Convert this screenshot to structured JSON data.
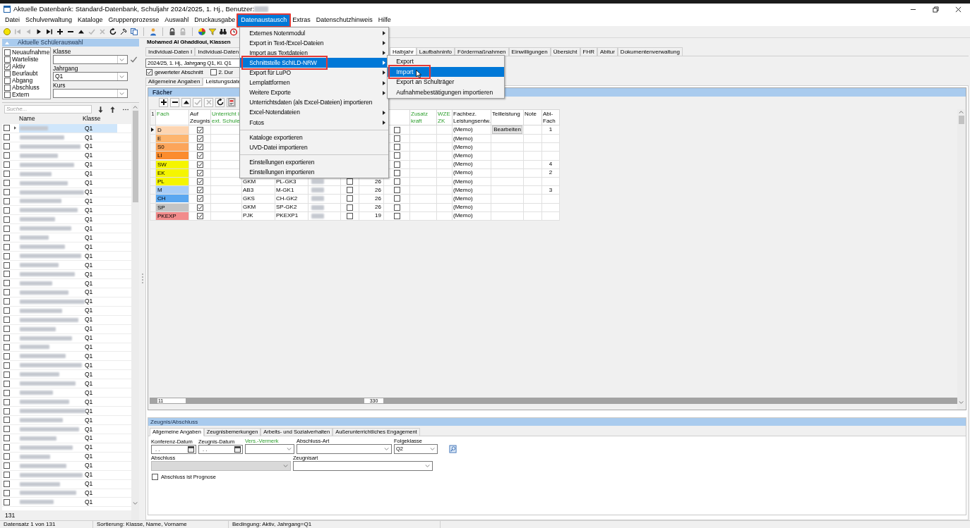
{
  "window": {
    "title": "Aktuelle Datenbank: Standard-Datenbank, Schuljahr 2024/2025, 1. Hj., Benutzer:"
  },
  "menu_bar": [
    {
      "label": "Datei",
      "selected": false
    },
    {
      "label": "Schulverwaltung",
      "selected": false
    },
    {
      "label": "Kataloge",
      "selected": false
    },
    {
      "label": "Gruppenprozesse",
      "selected": false
    },
    {
      "label": "Auswahl",
      "selected": false
    },
    {
      "label": "Druckausgabe",
      "selected": false
    },
    {
      "label": "Datenaustausch",
      "selected": true,
      "annotated": true
    },
    {
      "label": "Extras",
      "selected": false
    },
    {
      "label": "Datenschutzhinweis",
      "selected": false
    },
    {
      "label": "Hilfe",
      "selected": false
    }
  ],
  "open_menu": {
    "items": [
      {
        "kind": "item",
        "label": "Externes Notenmodul",
        "submenu": true,
        "selected": false
      },
      {
        "kind": "item",
        "label": "Export in Text-/Excel-Dateien",
        "submenu": true,
        "selected": false
      },
      {
        "kind": "item",
        "label": "Import aus Textdateien",
        "submenu": true,
        "selected": false
      },
      {
        "kind": "item",
        "label": "Schnittstelle SchILD-NRW",
        "submenu": true,
        "selected": true,
        "annotated": true,
        "children": [
          {
            "label": "Export",
            "selected": false
          },
          {
            "label": "Import",
            "selected": true,
            "annotated": true
          },
          {
            "label": "Export an Schulträger",
            "selected": false
          },
          {
            "label": "Aufnahmebestätigungen importieren",
            "selected": false
          }
        ]
      },
      {
        "kind": "item",
        "label": "Export für LuPO",
        "submenu": true,
        "selected": false
      },
      {
        "kind": "item",
        "label": "Lernplattformen",
        "submenu": true,
        "selected": false
      },
      {
        "kind": "item",
        "label": "Weitere Exporte",
        "submenu": true,
        "selected": false
      },
      {
        "kind": "item",
        "label": "Unterrichtsdaten (als Excel-Dateien) importieren",
        "submenu": false,
        "selected": false
      },
      {
        "kind": "item",
        "label": "Excel-Notendateien",
        "submenu": true,
        "selected": false
      },
      {
        "kind": "item",
        "label": "Fotos",
        "submenu": true,
        "selected": false
      },
      {
        "kind": "separator"
      },
      {
        "kind": "item",
        "label": "Kataloge exportieren",
        "submenu": false,
        "selected": false
      },
      {
        "kind": "item",
        "label": "UVD-Datei importieren",
        "submenu": false,
        "selected": false
      },
      {
        "kind": "separator"
      },
      {
        "kind": "item",
        "label": "Einstellungen exportieren",
        "submenu": false,
        "selected": false
      },
      {
        "kind": "item",
        "label": "Einstellungen importieren",
        "submenu": false,
        "selected": false
      }
    ]
  },
  "toolbar": [
    {
      "kind": "circle",
      "disabled": false
    },
    {
      "kind": "first",
      "disabled": true
    },
    {
      "kind": "prev",
      "disabled": true
    },
    {
      "kind": "play",
      "disabled": false
    },
    {
      "kind": "last",
      "disabled": false
    },
    {
      "kind": "plus",
      "disabled": false
    },
    {
      "kind": "minus",
      "disabled": false
    },
    {
      "kind": "up",
      "disabled": false
    },
    {
      "kind": "check",
      "disabled": true
    },
    {
      "kind": "cross",
      "disabled": true
    },
    {
      "kind": "refresh",
      "disabled": false
    },
    {
      "kind": "pin",
      "disabled": false
    },
    {
      "kind": "copy",
      "disabled": false
    },
    {
      "kind": "person",
      "disabled": false
    },
    {
      "kind": "lock",
      "disabled": false
    },
    {
      "kind": "lock",
      "disabled": true
    },
    {
      "kind": "wheel",
      "disabled": false
    },
    {
      "kind": "filter",
      "disabled": false
    },
    {
      "kind": "binoculars",
      "disabled": false
    },
    {
      "kind": "alarm",
      "disabled": false
    }
  ],
  "student_filter": {
    "title": "Aktuelle Schülerauswahl",
    "statuses": [
      {
        "label": "Neuaufnahme",
        "checked": false
      },
      {
        "label": "Warteliste",
        "checked": false
      },
      {
        "label": "Aktiv",
        "checked": true
      },
      {
        "label": "Beurlaubt",
        "checked": false
      },
      {
        "label": "Abgang",
        "checked": false
      },
      {
        "label": "Abschluss",
        "checked": false
      },
      {
        "label": "Extern",
        "checked": false
      }
    ],
    "fields": [
      {
        "label": "Klasse"
      },
      {
        "label": "Jahrgang",
        "value": "Q1"
      },
      {
        "label": "Kurs"
      }
    ]
  },
  "student_list": {
    "search_placeholder": "Suche...",
    "columns": [
      "Name",
      "Klasse"
    ],
    "count": "131",
    "rows": [
      {
        "klasse": "Q1",
        "selected": true
      },
      {
        "klasse": "Q1",
        "selected": false
      },
      {
        "klasse": "Q1",
        "selected": false
      },
      {
        "klasse": "Q1",
        "selected": false
      },
      {
        "klasse": "Q1",
        "selected": false
      },
      {
        "klasse": "Q1",
        "selected": false
      },
      {
        "klasse": "Q1",
        "selected": false
      },
      {
        "klasse": "Q1",
        "selected": false
      },
      {
        "klasse": "Q1",
        "selected": false
      },
      {
        "klasse": "Q1",
        "selected": false
      },
      {
        "klasse": "Q1",
        "selected": false
      },
      {
        "klasse": "Q1",
        "selected": false
      },
      {
        "klasse": "Q1",
        "selected": false
      },
      {
        "klasse": "Q1",
        "selected": false
      },
      {
        "klasse": "Q1",
        "selected": false
      },
      {
        "klasse": "Q1",
        "selected": false
      },
      {
        "klasse": "Q1",
        "selected": false
      },
      {
        "klasse": "Q1",
        "selected": false
      },
      {
        "klasse": "Q1",
        "selected": false
      },
      {
        "klasse": "Q1",
        "selected": false
      },
      {
        "klasse": "Q1",
        "selected": false
      },
      {
        "klasse": "Q1",
        "selected": false
      },
      {
        "klasse": "Q1",
        "selected": false
      },
      {
        "klasse": "Q1",
        "selected": false
      },
      {
        "klasse": "Q1",
        "selected": false
      },
      {
        "klasse": "Q1",
        "selected": false
      },
      {
        "klasse": "Q1",
        "selected": false
      },
      {
        "klasse": "Q1",
        "selected": false
      },
      {
        "klasse": "Q1",
        "selected": false
      },
      {
        "klasse": "Q1",
        "selected": false
      },
      {
        "klasse": "Q1",
        "selected": false
      },
      {
        "klasse": "Q1",
        "selected": false
      },
      {
        "klasse": "Q1",
        "selected": false
      },
      {
        "klasse": "Q1",
        "selected": false
      },
      {
        "klasse": "Q1",
        "selected": false
      },
      {
        "klasse": "Q1",
        "selected": false
      },
      {
        "klasse": "Q1",
        "selected": false
      },
      {
        "klasse": "Q1",
        "selected": false
      },
      {
        "klasse": "Q1",
        "selected": false
      },
      {
        "klasse": "Q1",
        "selected": false
      },
      {
        "klasse": "Q1",
        "selected": false
      },
      {
        "klasse": "Q1",
        "selected": false
      }
    ]
  },
  "student_header": "Mohamed Al Ghaddioui, Klassen",
  "tabs": [
    {
      "label": "Individual-Daten I",
      "selected": false
    },
    {
      "label": "Individual-Daten",
      "selected": false
    },
    {
      "label": "Halbjahr",
      "selected": true
    },
    {
      "label": "Laufbahninfo",
      "selected": false
    },
    {
      "label": "Fördermaßnahmen",
      "selected": false
    },
    {
      "label": "Einwilligungen",
      "selected": false
    },
    {
      "label": "Übersicht",
      "selected": false
    },
    {
      "label": "FHR",
      "selected": false
    },
    {
      "label": "Abitur",
      "selected": false
    },
    {
      "label": "Dokumentenverwaltung",
      "selected": false
    }
  ],
  "section_select": {
    "value": "2024/25, 1. Hj., Jahrgang Q1, Kl. Q1"
  },
  "section_options": [
    {
      "label": "gewerteter Abschnitt",
      "checked": true
    },
    {
      "label": "2. Dur",
      "checked": false
    }
  ],
  "subtabs": [
    {
      "label": "Allgemeine Angaben",
      "selected": false
    },
    {
      "label": "Leistungsdate",
      "selected": true
    }
  ],
  "subjects": {
    "title": "Fächer",
    "corner": "1",
    "toolbar": [
      {
        "kind": "plus",
        "disabled": false
      },
      {
        "kind": "minus",
        "disabled": false
      },
      {
        "kind": "up",
        "disabled": false
      },
      {
        "kind": "check",
        "disabled": true
      },
      {
        "kind": "cross",
        "disabled": true
      },
      {
        "kind": "refresh",
        "disabled": false
      },
      {
        "kind": "stamp",
        "disabled": false
      }
    ],
    "columns": [
      {
        "lines": [
          "Fach"
        ],
        "green": true
      },
      {
        "lines": [
          "Auf",
          "Zeugnis"
        ],
        "green": false
      },
      {
        "lines": [
          "Unterricht i",
          "ext. Schule"
        ],
        "green": true
      },
      {
        "lines": [
          "Zusatz",
          "kraft"
        ],
        "green": true
      },
      {
        "lines": [
          "WZE",
          "ZK"
        ],
        "green": true
      },
      {
        "lines": [
          "Fachbez.",
          "Leistungsentw."
        ],
        "green": false
      },
      {
        "lines": [
          "Teilleistung"
        ],
        "green": false
      },
      {
        "lines": [
          "Note"
        ],
        "green": false
      },
      {
        "lines": [
          "Abi-",
          "Fach"
        ],
        "green": false
      }
    ],
    "rows": [
      {
        "current": true,
        "fach": "D",
        "color": "#fdd5b1",
        "auf_zeugnis": true,
        "column_9": false,
        "fachbez": "(Memo)",
        "teilleistung": "Bearbeiten",
        "abi_fach": "1"
      },
      {
        "current": false,
        "fach": "E",
        "color": "#fdb56e",
        "auf_zeugnis": true,
        "column_9": false,
        "fachbez": "(Memo)"
      },
      {
        "current": false,
        "fach": "S0",
        "color": "#fca55a",
        "auf_zeugnis": true,
        "column_9": false,
        "fachbez": "(Memo)"
      },
      {
        "current": false,
        "fach": "LI",
        "color": "#fb8c2e",
        "auf_zeugnis": true,
        "column_9": false,
        "fachbez": "(Memo)"
      },
      {
        "current": false,
        "fach": "SW",
        "color": "#f5f500",
        "auf_zeugnis": true,
        "column_9": false,
        "fachbez": "(Memo)",
        "abi_fach": "4"
      },
      {
        "current": false,
        "fach": "EK",
        "color": "#f5f500",
        "auf_zeugnis": true,
        "column_9": false,
        "fachbez": "(Memo)",
        "abi_fach": "2"
      },
      {
        "current": false,
        "fach": "PL",
        "color": "#f5f500",
        "auf_zeugnis": true,
        "column_4": "GKM",
        "column_5": "PL-GK3",
        "column_6_redacted": true,
        "column_7": false,
        "column_8": "26",
        "column_9": false,
        "fachbez": "(Memo)"
      },
      {
        "current": false,
        "fach": "M",
        "color": "#a7cdf7",
        "auf_zeugnis": true,
        "column_4": "AB3",
        "column_5": "M-GK1",
        "column_6_redacted": true,
        "column_7": false,
        "column_8": "26",
        "column_9": false,
        "fachbez": "(Memo)",
        "abi_fach": "3"
      },
      {
        "current": false,
        "fach": "CH",
        "color": "#5aa7f0",
        "auf_zeugnis": true,
        "column_4": "GKS",
        "column_5": "CH-GK2",
        "column_6_redacted": true,
        "column_7": false,
        "column_8": "26",
        "column_9": false,
        "fachbez": "(Memo)"
      },
      {
        "current": false,
        "fach": "SP",
        "color": "#c4c4c4",
        "auf_zeugnis": true,
        "column_4": "GKM",
        "column_5": "SP-GK2",
        "column_6_redacted": true,
        "column_7": false,
        "column_8": "26",
        "column_9": false,
        "fachbez": "(Memo)"
      },
      {
        "current": false,
        "fach": "PKEXP",
        "color": "#f28b8b",
        "auf_zeugnis": true,
        "column_4": "PJK",
        "column_5": "PKEXP1",
        "column_6_redacted": true,
        "column_7": false,
        "column_8": "19",
        "column_9": false,
        "fachbez": "(Memo)"
      }
    ],
    "footer": {
      "count": "11",
      "hours_total": "330"
    }
  },
  "certificate": {
    "title": "Zeugnis/Abschluss",
    "tabs": [
      {
        "label": "Allgemeine Angaben",
        "selected": true
      },
      {
        "label": "Zeugnisbemerkungen",
        "selected": false
      },
      {
        "label": "Arbeits- und Sozialverhalten",
        "selected": false
      },
      {
        "label": "Außerunterrichtliches Engagement",
        "selected": false
      }
    ],
    "fields": [
      {
        "kind": "date",
        "label": "Konferenz-Datum",
        "value": ". .",
        "green": false,
        "disabled": false
      },
      {
        "kind": "date",
        "label": "Zeugnis-Datum",
        "value": ". .",
        "green": false,
        "disabled": false
      },
      {
        "kind": "combo",
        "label": "Vers.-Vermerk",
        "green": true,
        "disabled": false
      },
      {
        "kind": "combo",
        "label": "Abschluss-Art",
        "green": false,
        "disabled": false
      },
      {
        "kind": "combo",
        "label": "Folgeklasse",
        "value": "Q2",
        "green": false,
        "disabled": false
      },
      {
        "kind": "combo",
        "label": "Abschluss",
        "green": false,
        "disabled": true
      },
      {
        "kind": "combo",
        "label": "Zeugnisart",
        "green": false,
        "disabled": false
      }
    ],
    "prognosis": {
      "label": "Abschluss ist Prognose",
      "checked": false
    }
  },
  "status_bar": [
    "Datensatz 1 von 131",
    "Sortierung: Klasse, Name, Vorname",
    "Bedingung: Aktiv, Jahrgang=Q1"
  ]
}
